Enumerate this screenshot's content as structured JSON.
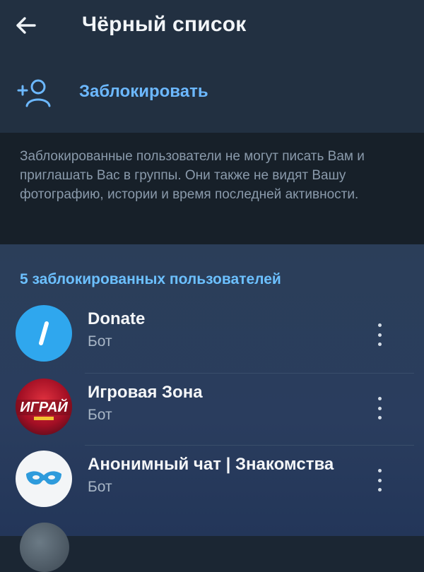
{
  "header": {
    "title": "Чёрный список",
    "back_icon": "arrow-left-icon"
  },
  "block_action": {
    "label": "Заблокировать",
    "icon": "add-user-icon",
    "color": "#6cb8ff"
  },
  "info": {
    "text": "Заблокированные пользователи не могут писать Вам и приглашать Вас в группы. Они также не видят Вашу фотографию, истории и время последней активности."
  },
  "blocked_list": {
    "title": "5 заблокированных пользователей",
    "items": [
      {
        "name": "Donate",
        "subtitle": "Бот",
        "avatar_icon": "slash-icon",
        "avatar_color": "#2fa7ee"
      },
      {
        "name": "Игровая Зона",
        "subtitle": "Бот",
        "avatar_icon": "game-logo-icon",
        "avatar_text": "ИГРАЙ",
        "avatar_color": "#b0112d"
      },
      {
        "name": "Анонимный чат | Знакомства",
        "subtitle": "Бот",
        "avatar_icon": "mask-icon",
        "avatar_color": "#f3f5f7"
      }
    ]
  },
  "colors": {
    "background": "#1b2633",
    "header": "#223041",
    "accent": "#6cc0ff"
  }
}
